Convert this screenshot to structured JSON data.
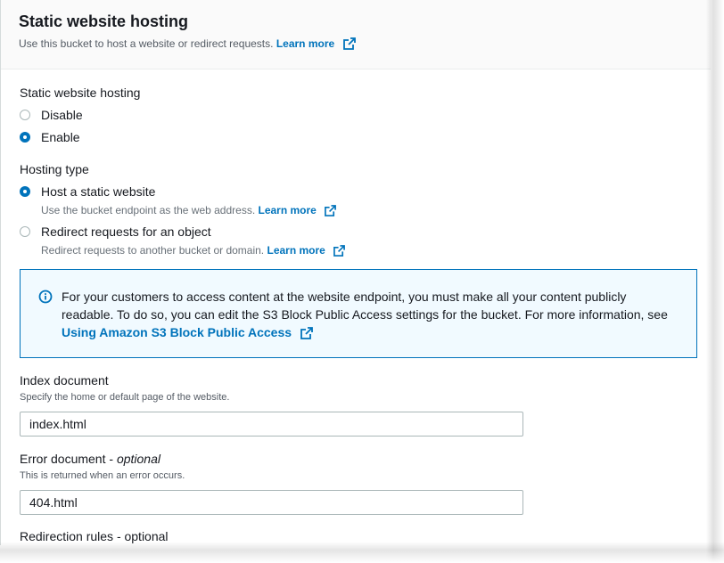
{
  "header": {
    "title": "Static website hosting",
    "subtitle": "Use this bucket to host a website or redirect requests.",
    "learn_more": "Learn more"
  },
  "hosting": {
    "label": "Static website hosting",
    "options": [
      {
        "label": "Disable",
        "checked": false
      },
      {
        "label": "Enable",
        "checked": true
      }
    ]
  },
  "hosting_type": {
    "label": "Hosting type",
    "options": [
      {
        "label": "Host a static website",
        "desc": "Use the bucket endpoint as the web address.",
        "learn_more": "Learn more",
        "checked": true
      },
      {
        "label": "Redirect requests for an object",
        "desc": "Redirect requests to another bucket or domain.",
        "learn_more": "Learn more",
        "checked": false
      }
    ]
  },
  "info": {
    "text": "For your customers to access content at the website endpoint, you must make all your content publicly readable. To do so, you can edit the S3 Block Public Access settings for the bucket. For more information, see",
    "link": "Using Amazon S3 Block Public Access"
  },
  "index_document": {
    "label": "Index document",
    "desc": "Specify the home or default page of the website.",
    "value": "index.html"
  },
  "error_document": {
    "label": "Error document - ",
    "optional": "optional",
    "desc": "This is returned when an error occurs.",
    "value": "404.html"
  },
  "redirection_rules": {
    "label": "Redirection rules - optional"
  },
  "colors": {
    "accent": "#0073bb",
    "info_bg": "#f1faff",
    "border": "#aab7b8"
  }
}
